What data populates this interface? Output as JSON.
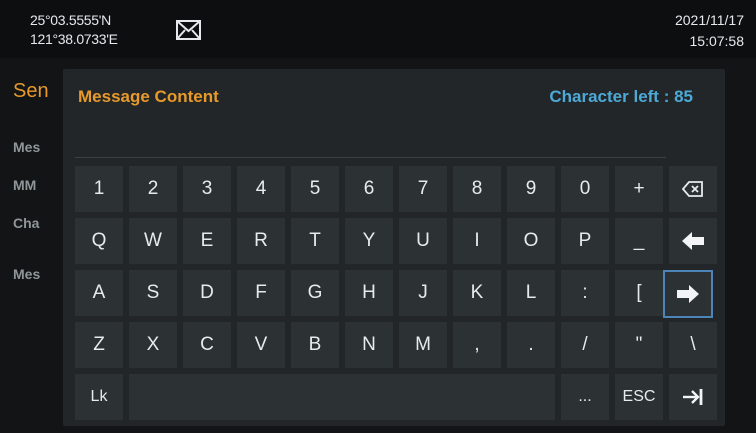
{
  "status": {
    "lat": "25°03.5555'N",
    "lon": "121°38.0733'E",
    "date": "2021/11/17",
    "time": "15:07:58",
    "mail_icon": "envelope-icon"
  },
  "background": {
    "title": "Sen",
    "labels": [
      "Mes",
      "MM",
      "Cha",
      "Mes"
    ]
  },
  "dialog": {
    "title": "Message Content",
    "char_left": "Character left : 85",
    "input_value": ""
  },
  "keyboard": {
    "rows": [
      [
        "1",
        "2",
        "3",
        "4",
        "5",
        "6",
        "7",
        "8",
        "9",
        "0",
        "+",
        "backspace-icon"
      ],
      [
        "Q",
        "W",
        "E",
        "R",
        "T",
        "Y",
        "U",
        "I",
        "O",
        "P",
        "_",
        "left-arrow-icon"
      ],
      [
        "A",
        "S",
        "D",
        "F",
        "G",
        "H",
        "J",
        "K",
        "L",
        ":",
        "[",
        "right-arrow-icon"
      ],
      [
        "Z",
        "X",
        "C",
        "V",
        "B",
        "N",
        "M",
        ",",
        ".",
        "/",
        "\"",
        "\\"
      ]
    ],
    "bottom_row": {
      "lock": "Lk",
      "space": "",
      "ellipsis": "...",
      "esc": "ESC",
      "tab_icon": "tab-icon"
    },
    "colors": {
      "key": "#2c3234",
      "focus": "#4d85b8",
      "accent": "#e79a2b",
      "info": "#4da9d6"
    }
  }
}
